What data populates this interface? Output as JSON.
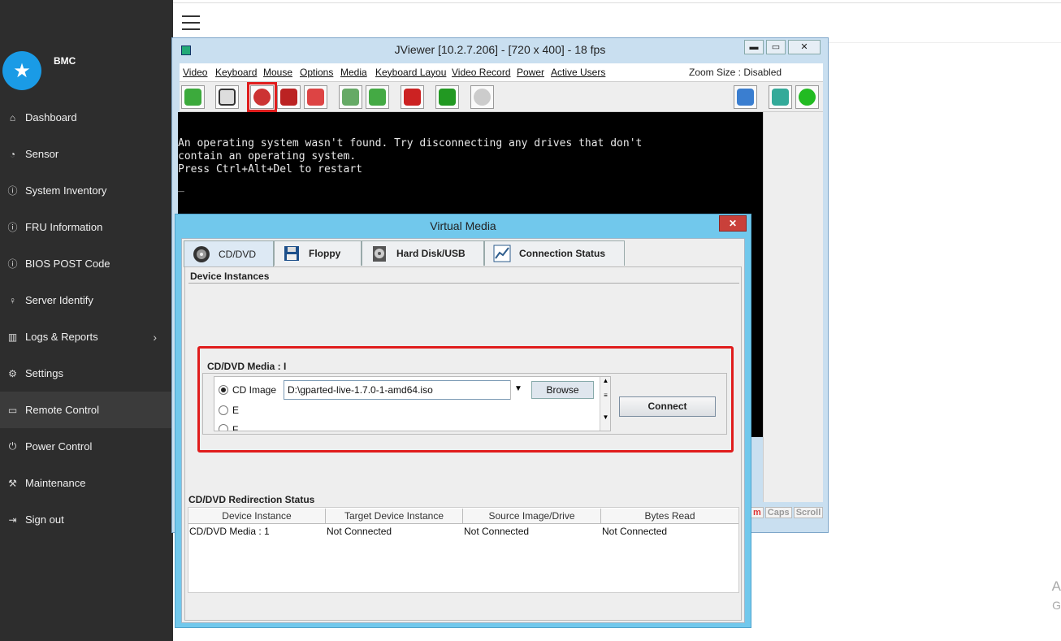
{
  "sidebar": {
    "brand": "BMC",
    "logo_icon": "star-icon",
    "items": [
      {
        "label": "Dashboard",
        "icon": "home-icon",
        "glyph": "⌂"
      },
      {
        "label": "Sensor",
        "icon": "gauge-icon",
        "glyph": "◔"
      },
      {
        "label": "System Inventory",
        "icon": "info-icon",
        "glyph": "ⓘ"
      },
      {
        "label": "FRU Information",
        "icon": "info-icon",
        "glyph": "ⓘ"
      },
      {
        "label": "BIOS POST Code",
        "icon": "info-icon",
        "glyph": "ⓘ"
      },
      {
        "label": "Server Identify",
        "icon": "lightbulb-icon",
        "glyph": "♀"
      },
      {
        "label": "Logs & Reports",
        "icon": "bar-chart-icon",
        "glyph": "▥"
      },
      {
        "label": "Settings",
        "icon": "gear-icon",
        "glyph": "⚙"
      },
      {
        "label": "Remote Control",
        "icon": "monitor-icon",
        "glyph": "▭"
      },
      {
        "label": "Power Control",
        "icon": "power-icon",
        "glyph": "⏻"
      },
      {
        "label": "Maintenance",
        "icon": "wrench-icon",
        "glyph": "⚒"
      },
      {
        "label": "Sign out",
        "icon": "sign-out-icon",
        "glyph": "⇥"
      }
    ],
    "active": "Remote Control"
  },
  "jviewer": {
    "title": "JViewer [10.2.7.206] - [720 x 400] - 18 fps",
    "window_buttons": {
      "minimize": "▬",
      "maximize": "▭",
      "close": "✕"
    },
    "menu": [
      "Video",
      "Keyboard",
      "Mouse",
      "Options",
      "Media",
      "Keyboard Layou",
      "Video Record",
      "Power",
      "Active Users"
    ],
    "zoom_text": "Zoom Size : Disabled",
    "console_lines": [
      "An operating system wasn't found. Try disconnecting any drives that don't",
      "contain an operating system.",
      "Press Ctrl+Alt+Del to restart",
      "_"
    ],
    "status_keys": [
      "m",
      "Caps",
      "Scroll"
    ]
  },
  "virtual_media": {
    "title": "Virtual Media",
    "close_glyph": "✕",
    "tabs": [
      "CD/DVD",
      "Floppy",
      "Hard Disk/USB",
      "Connection Status"
    ],
    "active_tab": "CD/DVD",
    "device_instances_label": "Device Instances",
    "media_label": "CD/DVD Media : I",
    "options": [
      "CD Image",
      "E",
      "F"
    ],
    "selected_option": "CD Image",
    "image_path": "D:\\gparted-live-1.7.0-1-amd64.iso",
    "browse_label": "Browse",
    "connect_label": "Connect",
    "redirection_status_label": "CD/DVD Redirection Status",
    "table_headers": [
      "Device Instance",
      "Target Device Instance",
      "Source Image/Drive",
      "Bytes Read"
    ],
    "table_row": [
      "CD/DVD Media :  1",
      "Not Connected",
      "Not Connected",
      "Not Connected"
    ]
  },
  "edge_text": [
    "A",
    "G"
  ],
  "colors": {
    "sidebar_bg": "#2d2d2d",
    "accent_blue": "#1a9be6",
    "highlight_red": "#e01c1c",
    "dialog_frame": "#71c8ec"
  }
}
